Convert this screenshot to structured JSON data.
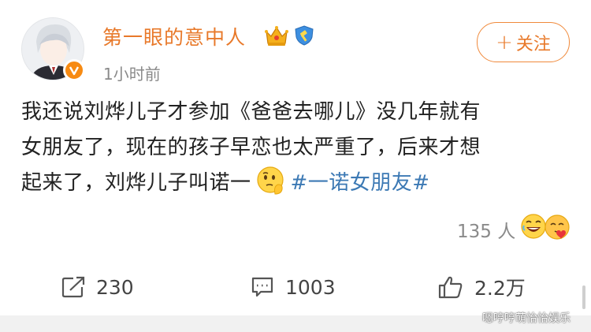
{
  "user": {
    "name": "第一眼的意中人",
    "timestamp": "1小时前",
    "follow_label": "关注",
    "follow_plus": "+"
  },
  "post": {
    "lines": [
      "我还说刘烨儿子才参加《爸爸去哪儿》没几年就有",
      "女朋友了，现在的孩子早恋也太严重了，后来才想",
      "起来了，刘烨儿子叫诺一"
    ],
    "hashtag": "#一诺女朋友#",
    "inline_emoji": "thinking-emoji"
  },
  "reactions": {
    "count": "135 人",
    "emojis": [
      "laugh-emoji",
      "love-emoji"
    ]
  },
  "actions": {
    "repost_count": "230",
    "comment_count": "1003",
    "like_count": "2.2万"
  },
  "watermark": "嗯哼哼萌怡怡娱乐",
  "colors": {
    "username": "#e8792a",
    "hashtag": "#3c79b4",
    "follow_border": "#f08a3c",
    "muted": "#8a8a8a"
  }
}
